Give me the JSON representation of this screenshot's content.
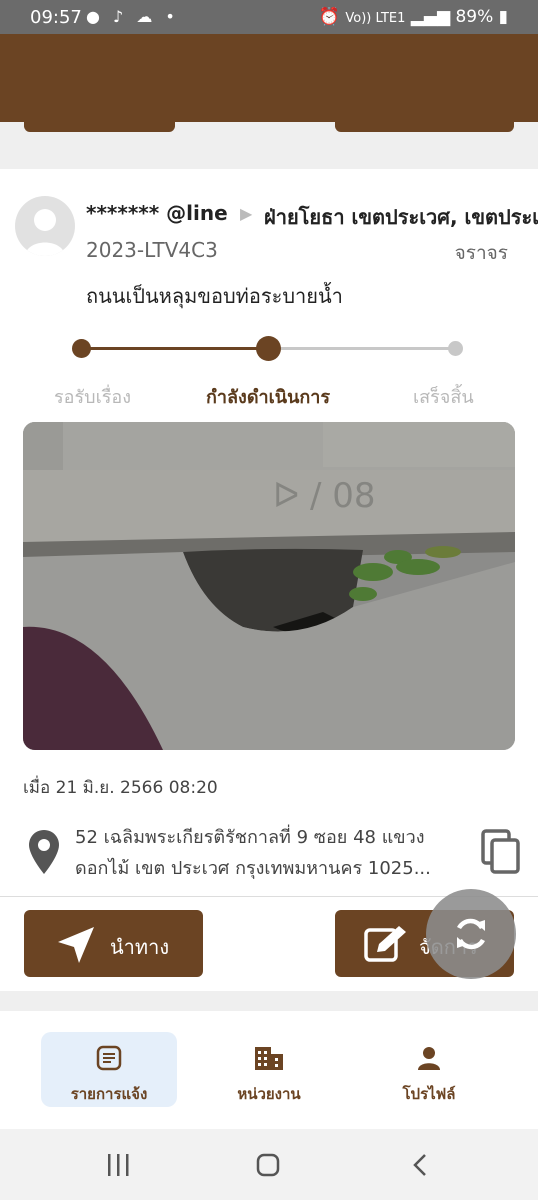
{
  "status_bar": {
    "time": "09:57",
    "battery": "89%",
    "network": "Vo)) LTE1"
  },
  "report": {
    "user": "******* @line",
    "department": "ฝ่ายโยธา เขตประเวศ, เขตประเวศ",
    "ticket_id": "2023-LTV4C3",
    "category": "จราจร",
    "description": "ถนนเป็นหลุมขอบท่อระบายน้ำ",
    "steps": [
      "รอรับเรื่อง",
      "กำลังดำเนินการ",
      "เสร็จสิ้น"
    ],
    "progress_step": 2,
    "photo_text": "ᐅ / 08",
    "date": "เมื่อ 21 มิ.ย. 2566 08:20",
    "address_line1": "52 เฉลิมพระเกียรติรัชกาลที่ 9 ซอย 48 แขวง",
    "address_line2": "ดอกไม้ เขต ประเวศ กรุงเทพมหานคร 1025..."
  },
  "actions": {
    "navigate_label": "นำทาง",
    "manage_label": "จัดการ"
  },
  "nav": {
    "items": [
      {
        "label": "รายการแจ้ง",
        "icon": "list-icon",
        "active": true
      },
      {
        "label": "หน่วยงาน",
        "icon": "building-icon",
        "active": false
      },
      {
        "label": "โปรไฟล์",
        "icon": "person-icon",
        "active": false
      }
    ]
  },
  "colors": {
    "brand": "#6b4423",
    "active_nav_bg": "#e5effa",
    "inactive_step": "#c8c8c8"
  }
}
